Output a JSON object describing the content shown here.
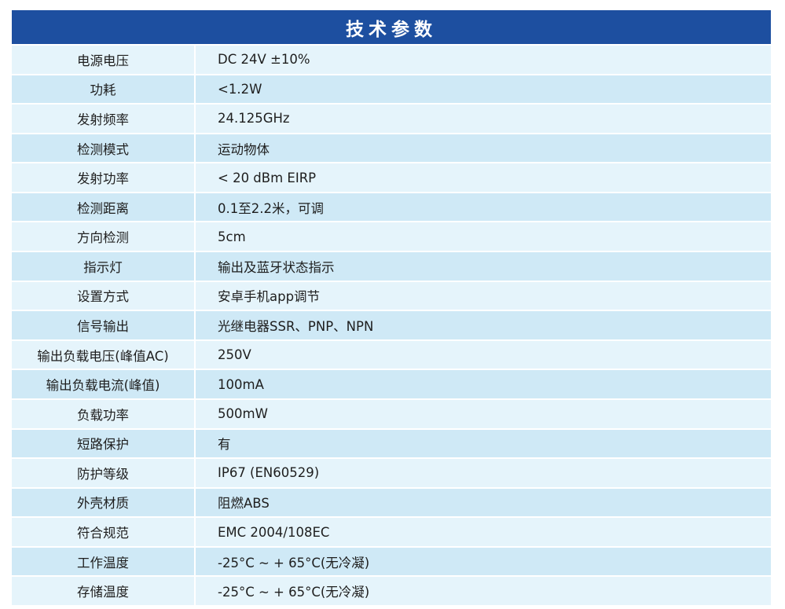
{
  "table": {
    "title": "技术参数",
    "header_color": "#1d4fa0",
    "rows": [
      {
        "label": "电源电压",
        "value": "DC 24V ±10%"
      },
      {
        "label": "功耗",
        "value": "<1.2W"
      },
      {
        "label": "发射频率",
        "value": "24.125GHz"
      },
      {
        "label": "检测模式",
        "value": "运动物体"
      },
      {
        "label": "发射功率",
        "value": "< 20 dBm EIRP"
      },
      {
        "label": "检测距离",
        "value": "0.1至2.2米，可调"
      },
      {
        "label": "方向检测",
        "value": "5cm"
      },
      {
        "label": "指示灯",
        "value": "输出及蓝牙状态指示"
      },
      {
        "label": "设置方式",
        "value": "安卓手机app调节"
      },
      {
        "label": "信号输出",
        "value": "光继电器SSR、PNP、NPN"
      },
      {
        "label": "输出负载电压(峰值AC)",
        "value": "250V"
      },
      {
        "label": "输出负载电流(峰值)",
        "value": "100mA"
      },
      {
        "label": "负载功率",
        "value": "500mW"
      },
      {
        "label": "短路保护",
        "value": "有"
      },
      {
        "label": "防护等级",
        "value": "IP67 (EN60529)"
      },
      {
        "label": "外壳材质",
        "value": "阻燃ABS"
      },
      {
        "label": "符合规范",
        "value": "EMC 2004/108EC"
      },
      {
        "label": "工作温度",
        "value": "-25°C ~ + 65°C(无冷凝)"
      },
      {
        "label": "存储温度",
        "value": "-25°C ~ + 65°C(无冷凝)"
      }
    ]
  }
}
